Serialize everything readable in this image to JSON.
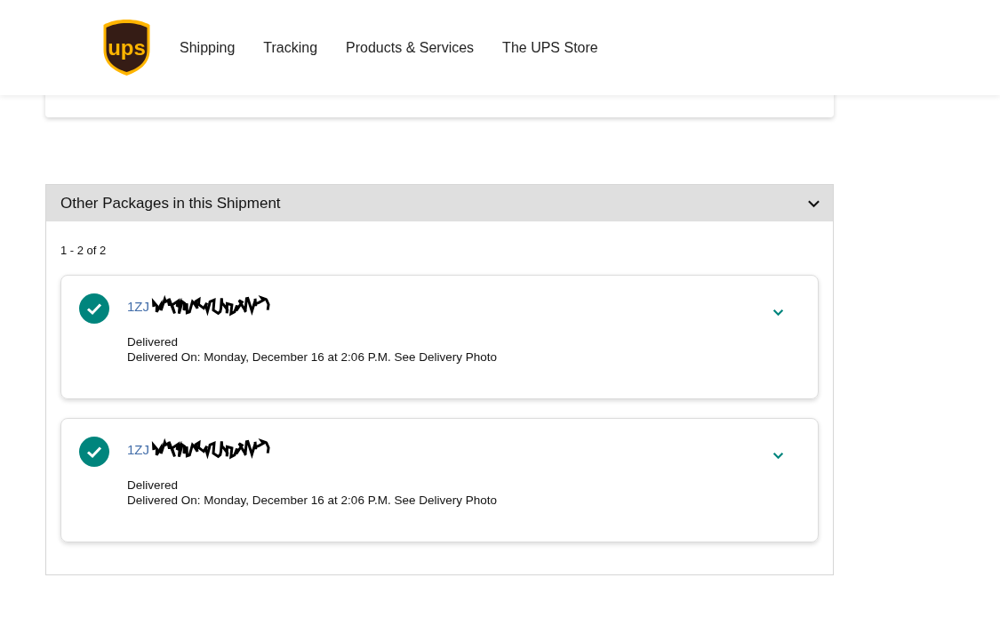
{
  "header": {
    "logo": "ups",
    "nav": [
      {
        "label": "Shipping"
      },
      {
        "label": "Tracking"
      },
      {
        "label": "Products & Services"
      },
      {
        "label": "The UPS Store"
      }
    ]
  },
  "section": {
    "title": "Other Packages in this Shipment",
    "expanded": true,
    "count": "1 - 2 of 2",
    "packages": [
      {
        "tracking_number": "1ZJ",
        "status": "Delivered",
        "detail": "Delivered On: Monday, December 16 at 2:06 P.M. See Delivery Photo",
        "expanded": false
      },
      {
        "tracking_number": "1ZJ",
        "status": "Delivered",
        "detail": "Delivered On: Monday, December 16 at 2:06 P.M. See Delivery Photo",
        "expanded": false
      }
    ]
  }
}
